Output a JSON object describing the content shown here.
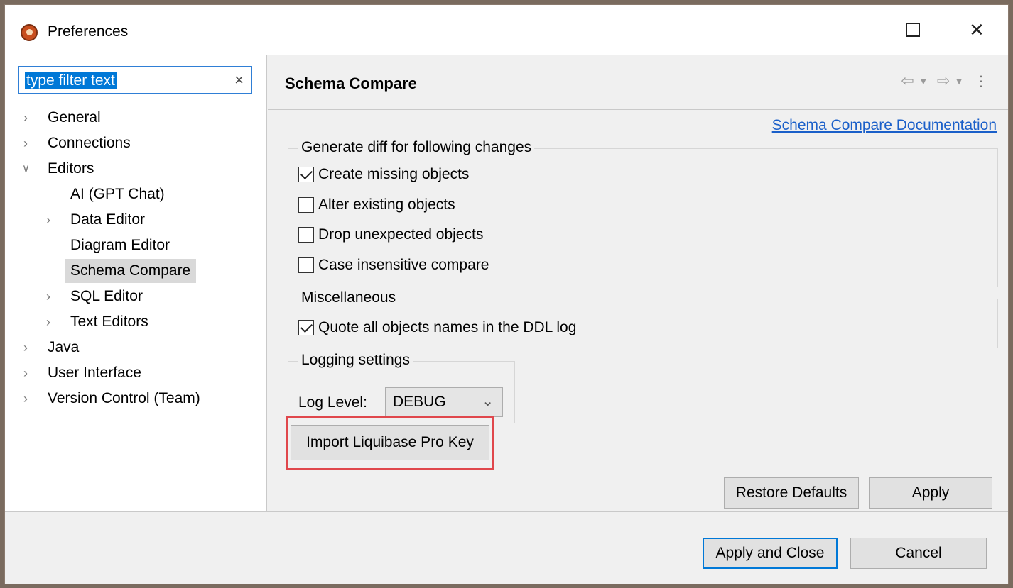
{
  "window": {
    "title": "Preferences"
  },
  "window_controls": {
    "minimize": "—",
    "maximize": "☐",
    "close": "✕"
  },
  "filter": {
    "value": "type filter text",
    "clear": "×"
  },
  "tree": {
    "general": "General",
    "connections": "Connections",
    "editors": "Editors",
    "ai_gpt_chat": "AI (GPT Chat)",
    "data_editor": "Data Editor",
    "diagram_editor": "Diagram Editor",
    "schema_compare": "Schema Compare",
    "sql_editor": "SQL Editor",
    "text_editors": "Text Editors",
    "java": "Java",
    "user_interface": "User Interface",
    "version_control": "Version Control (Team)"
  },
  "page": {
    "title": "Schema Compare",
    "doc_link": "Schema Compare Documentation"
  },
  "diff_group": {
    "legend": "Generate diff for following changes",
    "create_missing": {
      "label": "Create missing objects",
      "checked": true
    },
    "alter_existing": {
      "label": "Alter existing objects",
      "checked": false
    },
    "drop_unexpected": {
      "label": "Drop unexpected objects",
      "checked": false
    },
    "case_insensitive": {
      "label": "Case insensitive compare",
      "checked": false
    }
  },
  "misc_group": {
    "legend": "Miscellaneous",
    "quote_names": {
      "label": "Quote all objects names in the DDL log",
      "checked": true
    }
  },
  "logging_group": {
    "legend": "Logging settings",
    "log_level_label": "Log Level:",
    "log_level_value": "DEBUG"
  },
  "buttons": {
    "import_key": "Import Liquibase Pro Key",
    "restore_defaults": "Restore Defaults",
    "apply": "Apply",
    "apply_and_close": "Apply and Close",
    "cancel": "Cancel"
  },
  "colors": {
    "accent": "#0078d7",
    "link": "#1a5fc9",
    "highlight": "#e0474c"
  }
}
